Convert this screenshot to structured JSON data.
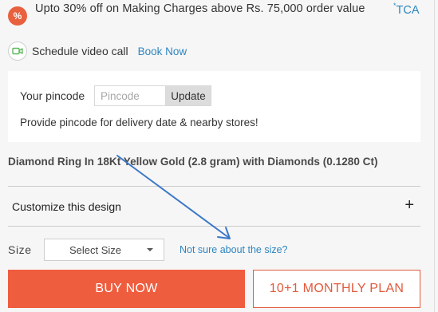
{
  "offer": {
    "badge_icon": "discount-badge-icon",
    "text": "Upto 30% off on Making Charges above Rs. 75,000 order value",
    "tca_mark": "*",
    "tca_label": "TCA"
  },
  "video_call": {
    "icon": "video-camera-icon",
    "label": "Schedule video call",
    "link": "Book Now"
  },
  "pincode": {
    "label": "Your pincode",
    "placeholder": "Pincode",
    "value": "",
    "button": "Update",
    "note": "Provide pincode for delivery date & nearby stores!"
  },
  "product": {
    "title": "Diamond Ring In 18Kt Yellow Gold (2.8 gram) with Diamonds (0.1280 Ct)"
  },
  "customize": {
    "label": "Customize this design",
    "expand_symbol": "+"
  },
  "size": {
    "label": "Size",
    "select_value": "Select Size",
    "help_link": "Not sure about the size?"
  },
  "actions": {
    "buy_now": "BUY NOW",
    "monthly_plan": "10+1 MONTHLY PLAN"
  },
  "colors": {
    "accent": "#ef5d3f",
    "link": "#2e86c1",
    "annotation_arrow": "#3b78c8"
  }
}
